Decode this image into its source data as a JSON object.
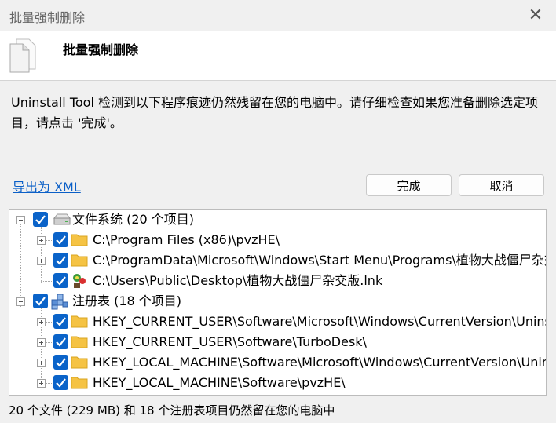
{
  "window": {
    "title": "批量强制删除",
    "close_icon": "close-icon"
  },
  "header": {
    "title": "批量强制删除",
    "icon": "documents-icon"
  },
  "description": "Uninstall Tool 检测到以下程序痕迹仍然残留在您的电脑中。请仔细检查如果您准备删除选定项目，请点击 '完成'。",
  "export_link": "导出为 XML",
  "buttons": {
    "done": "完成",
    "cancel": "取消"
  },
  "tree": {
    "filesystem": {
      "label": "文件系统 (20 个项目)",
      "icon": "drive-icon",
      "checked": true,
      "items": [
        {
          "label": "C:\\Program Files (x86)\\pvzHE\\",
          "icon": "folder-icon",
          "checked": true,
          "expandable": true
        },
        {
          "label": "C:\\ProgramData\\Microsoft\\Windows\\Start Menu\\Programs\\植物大战僵尸杂交版",
          "icon": "folder-icon",
          "checked": true,
          "expandable": true
        },
        {
          "label": "C:\\Users\\Public\\Desktop\\植物大战僵尸杂交版.lnk",
          "icon": "game-shortcut-icon",
          "checked": true,
          "expandable": false
        }
      ]
    },
    "registry": {
      "label": "注册表 (18 个项目)",
      "icon": "registry-icon",
      "checked": true,
      "items": [
        {
          "label": "HKEY_CURRENT_USER\\Software\\Microsoft\\Windows\\CurrentVersion\\Uninstall",
          "icon": "folder-icon",
          "checked": true,
          "expandable": true
        },
        {
          "label": "HKEY_CURRENT_USER\\Software\\TurboDesk\\",
          "icon": "folder-icon",
          "checked": true,
          "expandable": true
        },
        {
          "label": "HKEY_LOCAL_MACHINE\\Software\\Microsoft\\Windows\\CurrentVersion\\Uninstall",
          "icon": "folder-icon",
          "checked": true,
          "expandable": true
        },
        {
          "label": "HKEY_LOCAL_MACHINE\\Software\\pvzHE\\",
          "icon": "folder-icon",
          "checked": true,
          "expandable": true
        }
      ]
    }
  },
  "status": "20 个文件 (229 MB) 和 18 个注册表项目仍然留在您的电脑中",
  "colors": {
    "checkbox": "#0a63c9",
    "link": "#0a5fc7",
    "folder": "#f5c344"
  }
}
